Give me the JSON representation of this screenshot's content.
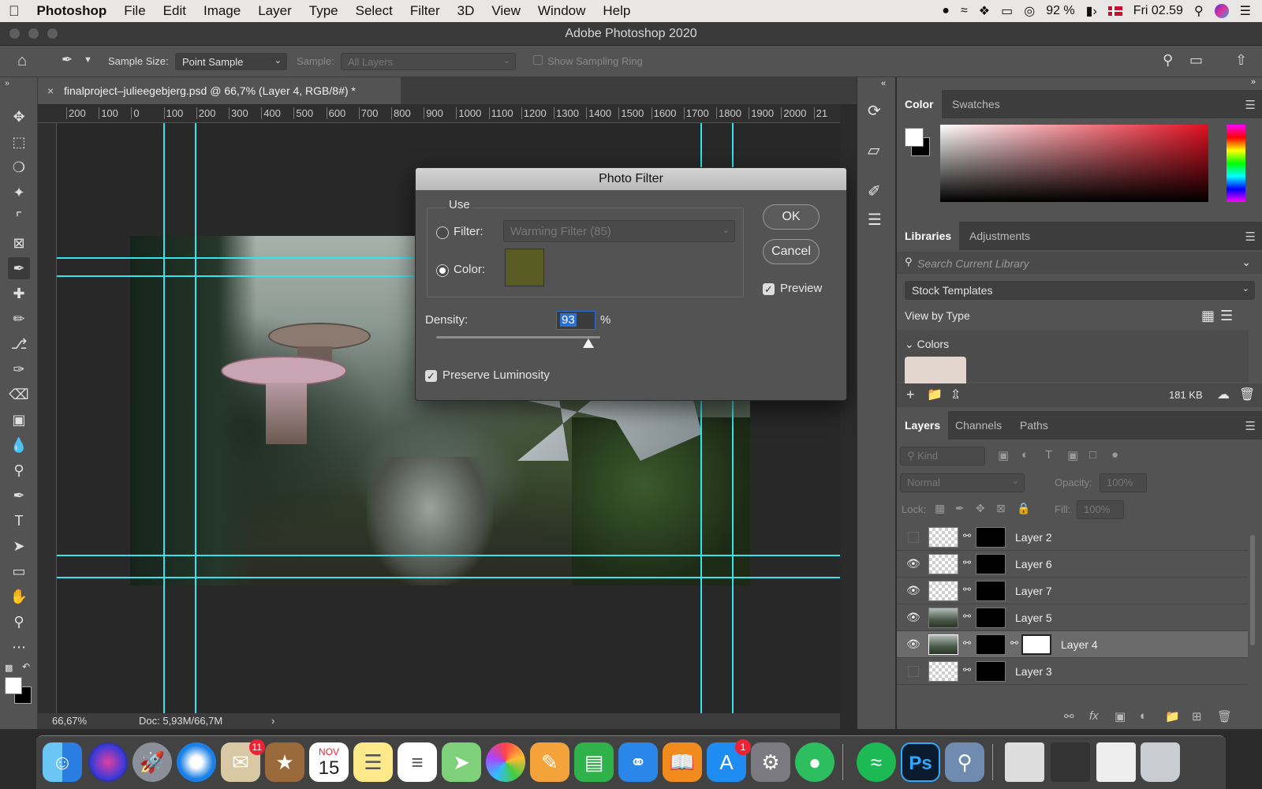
{
  "menubar": {
    "app": "Photoshop",
    "items": [
      "File",
      "Edit",
      "Image",
      "Layer",
      "Type",
      "Select",
      "Filter",
      "3D",
      "View",
      "Window",
      "Help"
    ],
    "battery": "92 %",
    "clock": "Fri 02.59"
  },
  "window": {
    "title": "Adobe Photoshop 2020"
  },
  "options": {
    "sample_size_label": "Sample Size:",
    "sample_size_value": "Point Sample",
    "sample_label": "Sample:",
    "sample_value": "All Layers",
    "sampling_ring": "Show Sampling Ring"
  },
  "document": {
    "tab_title": "finalproject–julieegebjerg.psd @ 66,7% (Layer 4, RGB/8#) *",
    "ruler_ticks": [
      "200",
      "100",
      "0",
      "100",
      "200",
      "300",
      "400",
      "500",
      "600",
      "700",
      "800",
      "900",
      "1000",
      "1100",
      "1200",
      "1300",
      "1400",
      "1500",
      "1600",
      "1700",
      "1800",
      "1900",
      "2000",
      "21"
    ],
    "zoom": "66,67%",
    "doc_size": "Doc: 5,93M/66,7M"
  },
  "dialog": {
    "title": "Photo Filter",
    "use_label": "Use",
    "filter_label": "Filter:",
    "filter_value": "Warming Filter (85)",
    "color_label": "Color:",
    "color_swatch": "#5a5a24",
    "ok": "OK",
    "cancel": "Cancel",
    "preview": "Preview",
    "density_label": "Density:",
    "density_value": "93",
    "density_unit": "%",
    "density_level": 0.93,
    "preserve": "Preserve Luminosity"
  },
  "color_panel": {
    "tabs": [
      "Color",
      "Swatches"
    ]
  },
  "libraries": {
    "tabs": [
      "Libraries",
      "Adjustments"
    ],
    "search_placeholder": "Search Current Library",
    "library_select": "Stock Templates",
    "view_by": "View by Type",
    "section": "Colors",
    "size": "181 KB"
  },
  "layers_panel": {
    "tabs": [
      "Layers",
      "Channels",
      "Paths"
    ],
    "kind": "Kind",
    "blend": "Normal",
    "opacity_label": "Opacity:",
    "opacity_value": "100%",
    "lock_label": "Lock:",
    "fill_label": "Fill:",
    "fill_value": "100%",
    "layers": [
      {
        "name": "Layer 2",
        "visible": false,
        "selected": false
      },
      {
        "name": "Layer 6",
        "visible": true,
        "selected": false
      },
      {
        "name": "Layer 7",
        "visible": true,
        "selected": false
      },
      {
        "name": "Layer 5",
        "visible": true,
        "selected": false
      },
      {
        "name": "Layer 4",
        "visible": true,
        "selected": true
      },
      {
        "name": "Layer 3",
        "visible": false,
        "selected": false
      }
    ]
  },
  "dock": {
    "mail_badge": "11",
    "appstore_badge": "1",
    "calendar_month": "NOV",
    "calendar_day": "15",
    "ps_label": "Ps"
  },
  "colors": {
    "guide": "#35e3ee",
    "accent": "#2d6fd0"
  }
}
